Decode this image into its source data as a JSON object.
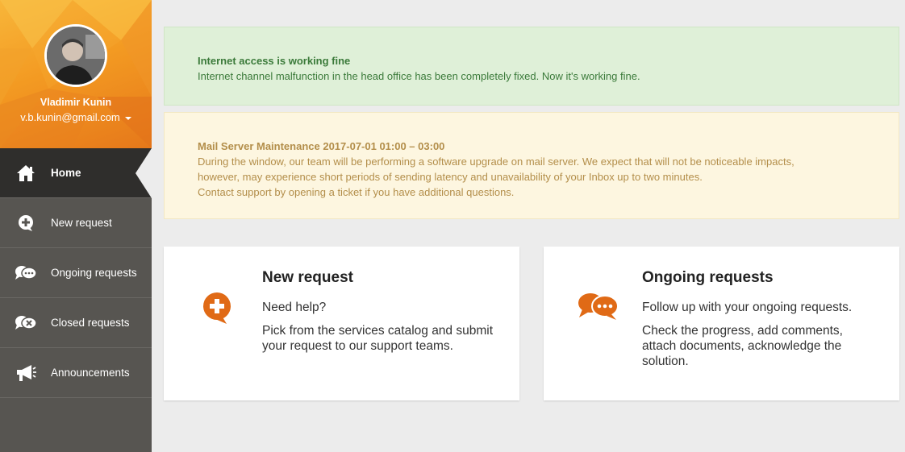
{
  "user": {
    "name": "Vladimir Kunin",
    "email": "v.b.kunin@gmail.com"
  },
  "nav": {
    "items": [
      {
        "label": "Home",
        "icon": "home-icon",
        "active": true
      },
      {
        "label": "New request",
        "icon": "plus-bubble-icon"
      },
      {
        "label": "Ongoing requests",
        "icon": "chat-bubbles-icon"
      },
      {
        "label": "Closed requests",
        "icon": "closed-bubbles-icon"
      },
      {
        "label": "Announcements",
        "icon": "megaphone-icon"
      }
    ]
  },
  "alerts": {
    "success": {
      "title": "Internet access is working fine",
      "body": "Internet channel malfunction in the head office has been completely fixed. Now it's working fine."
    },
    "warning": {
      "title": "Mail Server Maintenance 2017-07-01 01:00 – 03:00",
      "line1": "During the window, our team will be performing a software upgrade on mail server. We expect that will not be noticeable impacts,",
      "line2": "however, may experience short periods of sending latency and unavailability of your Inbox up to two minutes.",
      "line3": "Contact support by opening a ticket if you have additional questions."
    }
  },
  "cards": {
    "new_request": {
      "title": "New request",
      "lead": "Need help?",
      "desc": "Pick from the services catalog and submit your request to our support teams."
    },
    "ongoing": {
      "title": "Ongoing requests",
      "lead": "Follow up with your ongoing requests.",
      "desc": "Check the progress, add comments, attach documents, acknowledge the solution."
    }
  },
  "colors": {
    "accent": "#e06a16",
    "sidebar": "#575551",
    "sidebar_active": "#2f2e2c",
    "success_bg": "#dff0d8",
    "warning_bg": "#fdf6e0"
  }
}
